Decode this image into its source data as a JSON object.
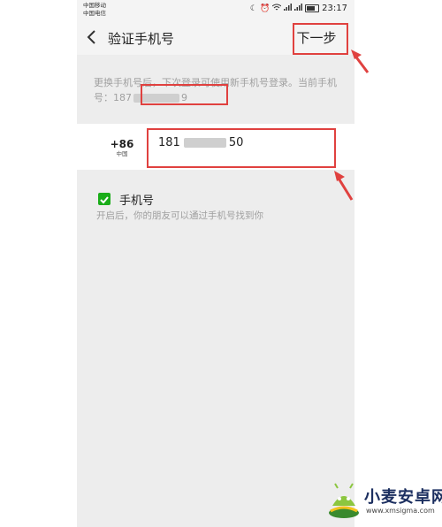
{
  "status_bar": {
    "carrier_1": "中国移动",
    "carrier_2": "中国电信",
    "time": "23:17"
  },
  "header": {
    "back_icon": "chevron-left-icon",
    "title": "验证手机号",
    "next_label": "下一步"
  },
  "hint": {
    "line": "更换手机号后，下次登录可使用新手机号登录。当前手机号：",
    "current_prefix": "187",
    "current_suffix": "9"
  },
  "phone_field": {
    "country_code": "+86",
    "region": "中国",
    "prefix": "181",
    "suffix": "50"
  },
  "discoverable": {
    "checked": true,
    "label": "手机号",
    "description": "开启后，你的朋友可以通过手机号找到你"
  },
  "watermark": {
    "name": "小麦安卓网",
    "url": "www.xmsigma.com"
  },
  "colors": {
    "accent_green": "#1aad19",
    "annotation_red": "#e0413f",
    "background": "#ededed"
  }
}
